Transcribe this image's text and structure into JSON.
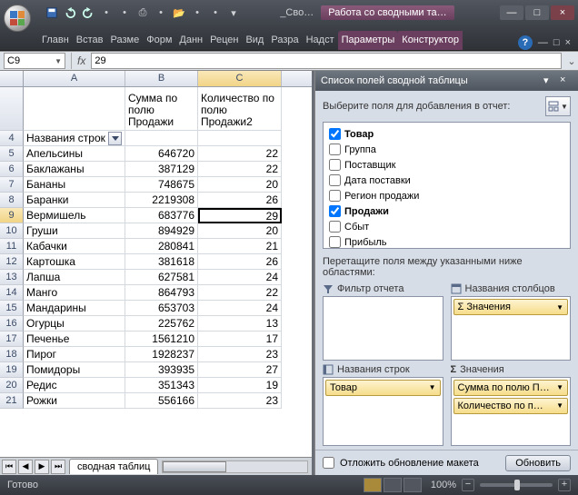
{
  "title": {
    "doc": "_Сво…",
    "context": "Работа со сводными та…"
  },
  "window_controls": {
    "min": "_",
    "max": "□",
    "close": "×"
  },
  "ribbon_tabs": [
    "Главн",
    "Встав",
    "Разме",
    "Форм",
    "Данн",
    "Рецен",
    "Вид",
    "Разра",
    "Надст",
    "Параметры",
    "Конструктор"
  ],
  "name_box": "C9",
  "fx": "fx",
  "formula": "29",
  "columns": [
    "A",
    "B",
    "C"
  ],
  "pivot_headers": {
    "B": "Сумма по полю Продажи",
    "C": "Количество по полю Продажи2"
  },
  "row_label_header": "Названия строк",
  "rows": [
    {
      "n": 5,
      "a": "Апельсины",
      "b": "646720",
      "c": "22"
    },
    {
      "n": 6,
      "a": "Баклажаны",
      "b": "387129",
      "c": "22"
    },
    {
      "n": 7,
      "a": "Бананы",
      "b": "748675",
      "c": "20"
    },
    {
      "n": 8,
      "a": "Баранки",
      "b": "2219308",
      "c": "26"
    },
    {
      "n": 9,
      "a": "Вермишель",
      "b": "683776",
      "c": "29"
    },
    {
      "n": 10,
      "a": "Груши",
      "b": "894929",
      "c": "20"
    },
    {
      "n": 11,
      "a": "Кабачки",
      "b": "280841",
      "c": "21"
    },
    {
      "n": 12,
      "a": "Картошка",
      "b": "381618",
      "c": "26"
    },
    {
      "n": 13,
      "a": "Лапша",
      "b": "627581",
      "c": "24"
    },
    {
      "n": 14,
      "a": "Манго",
      "b": "864793",
      "c": "22"
    },
    {
      "n": 15,
      "a": "Мандарины",
      "b": "653703",
      "c": "24"
    },
    {
      "n": 16,
      "a": "Огурцы",
      "b": "225762",
      "c": "13"
    },
    {
      "n": 17,
      "a": "Печенье",
      "b": "1561210",
      "c": "17"
    },
    {
      "n": 18,
      "a": "Пирог",
      "b": "1928237",
      "c": "23"
    },
    {
      "n": 19,
      "a": "Помидоры",
      "b": "393935",
      "c": "27"
    },
    {
      "n": 20,
      "a": "Редис",
      "b": "351343",
      "c": "19"
    },
    {
      "n": 21,
      "a": "Рожки",
      "b": "556166",
      "c": "23"
    }
  ],
  "sheet_tab": "сводная таблиц",
  "fieldlist": {
    "title": "Список полей сводной таблицы",
    "choose": "Выберите поля для добавления в отчет:",
    "fields": [
      {
        "name": "Товар",
        "checked": true
      },
      {
        "name": "Группа",
        "checked": false
      },
      {
        "name": "Поставщик",
        "checked": false
      },
      {
        "name": "Дата поставки",
        "checked": false
      },
      {
        "name": "Регион продажи",
        "checked": false
      },
      {
        "name": "Продажи",
        "checked": true
      },
      {
        "name": "Сбыт",
        "checked": false
      },
      {
        "name": "Прибыль",
        "checked": false
      }
    ],
    "drag": "Перетащите поля между указанными ниже областями:",
    "areas": {
      "filter": "Фильтр отчета",
      "cols": "Названия столбцов",
      "rows": "Названия строк",
      "vals": "Значения"
    },
    "col_items": [
      "Σ  Значения"
    ],
    "row_items": [
      "Товар"
    ],
    "val_items": [
      "Сумма по полю П…",
      "Количество по п…"
    ],
    "defer": "Отложить обновление макета",
    "update": "Обновить"
  },
  "status": {
    "ready": "Готово",
    "zoom": "100%"
  }
}
